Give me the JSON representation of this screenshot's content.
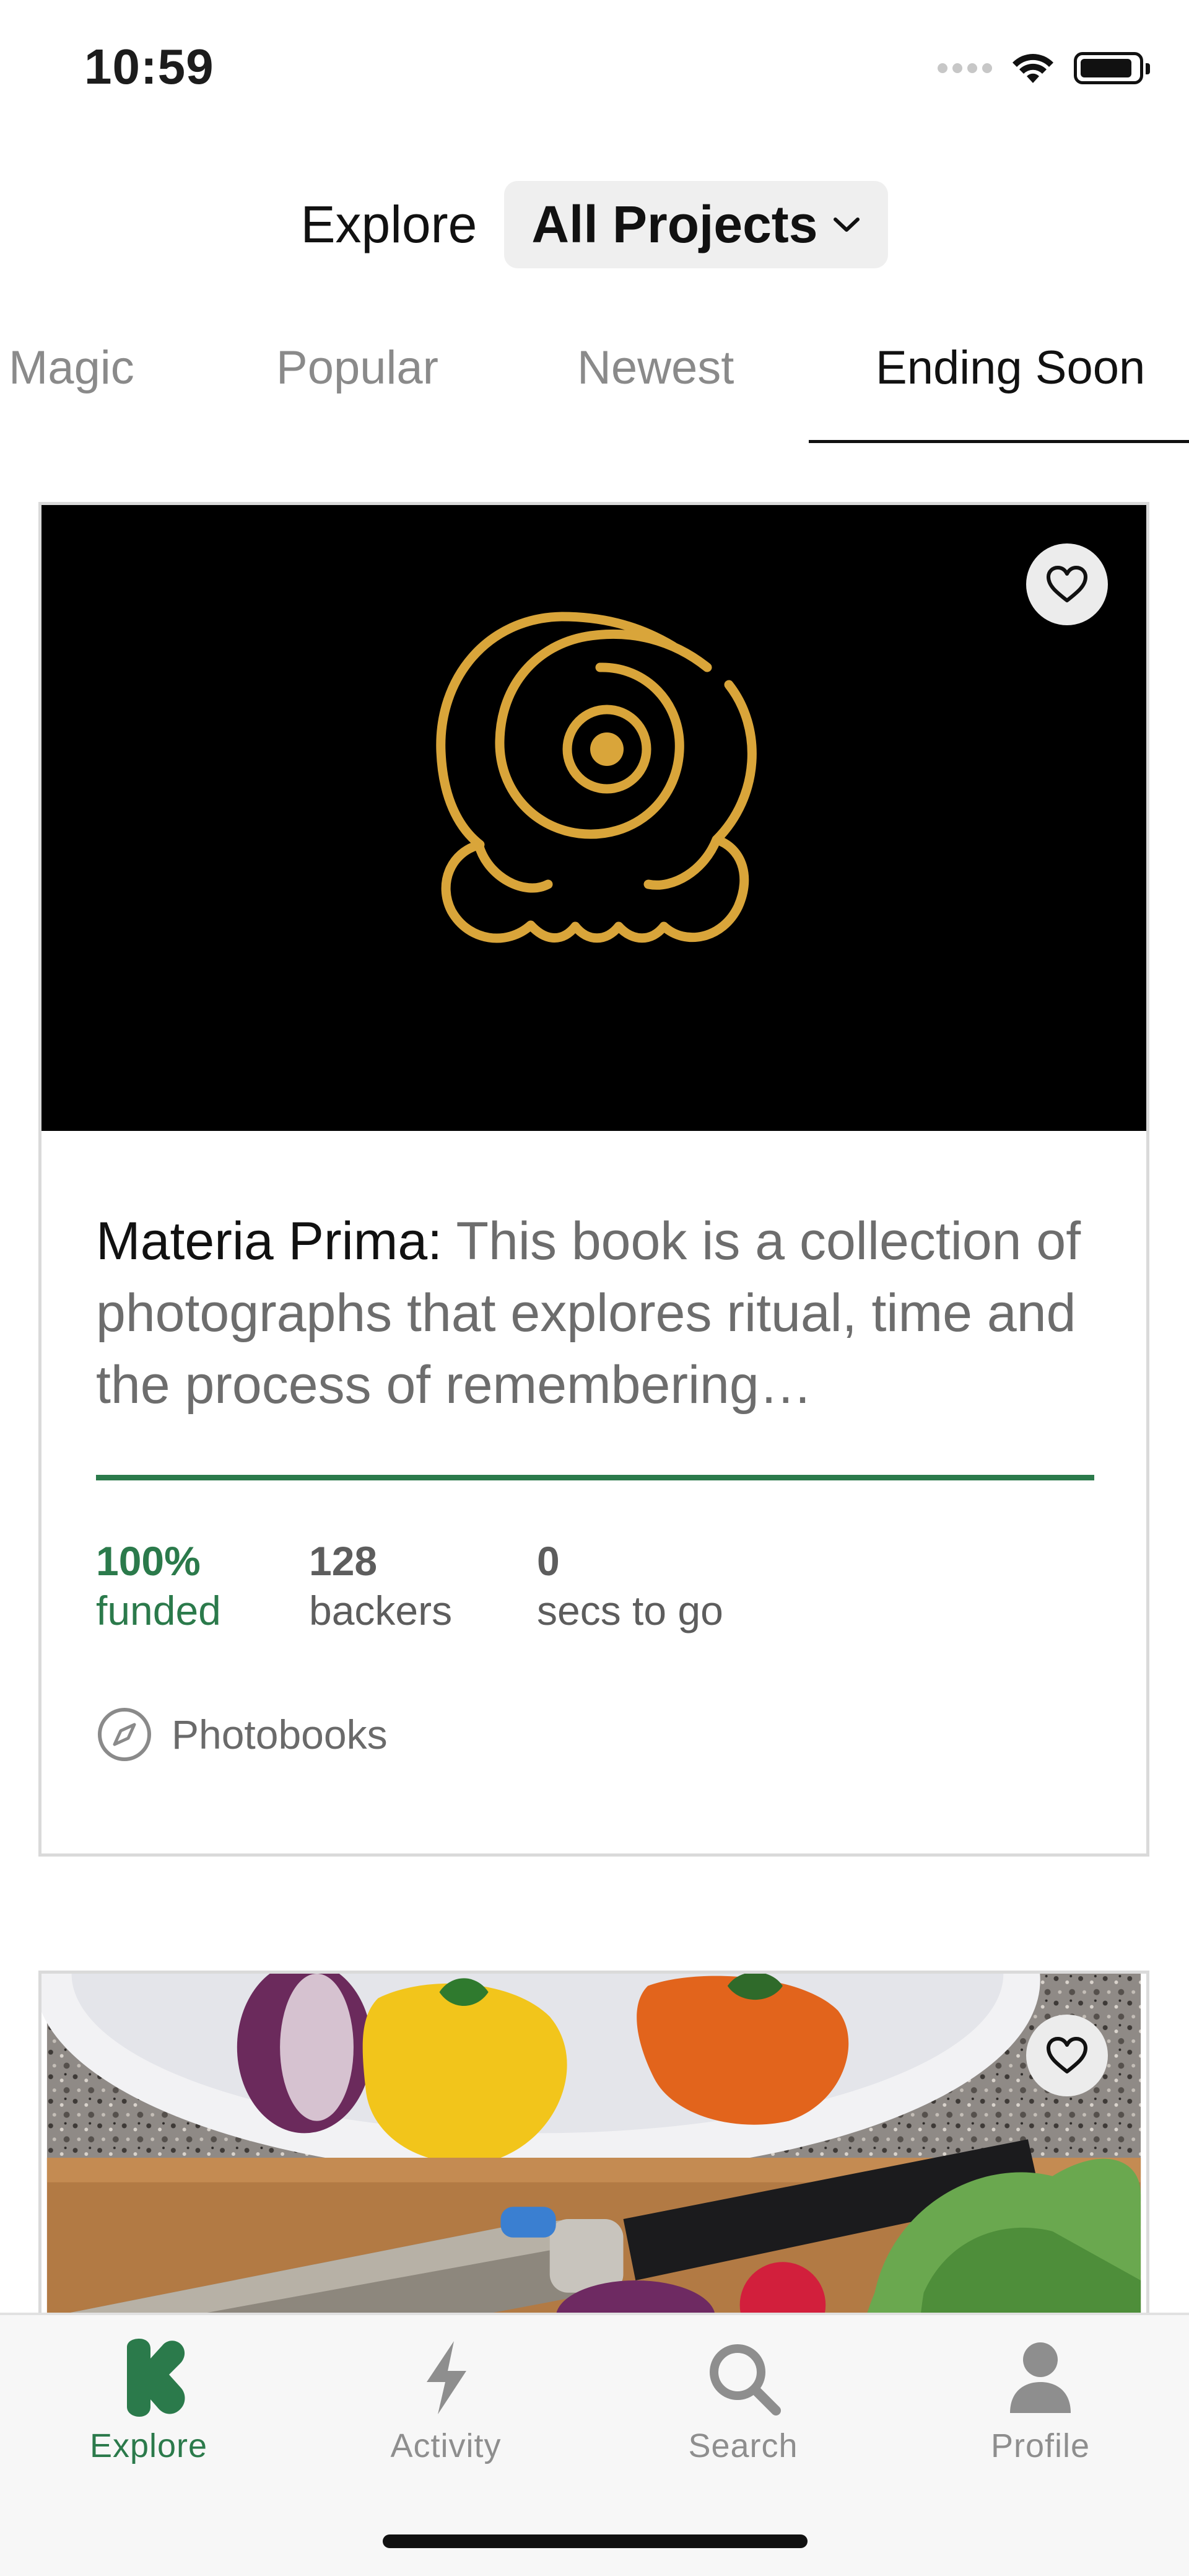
{
  "status_bar": {
    "time": "10:59"
  },
  "header": {
    "label": "Explore",
    "dropdown_value": "All Projects"
  },
  "tabs": [
    {
      "label": "Magic",
      "active": false
    },
    {
      "label": "Popular",
      "active": false
    },
    {
      "label": "Newest",
      "active": false
    },
    {
      "label": "Ending Soon",
      "active": true
    }
  ],
  "projects": [
    {
      "name": "Materia Prima:",
      "blurb": "This book is a collection of photographs that explores ritual, time and the process of remembering…",
      "funded_fraction": 1.0,
      "stats": {
        "funded_value": "100%",
        "funded_label": "funded",
        "backers_value": "128",
        "backers_label": "backers",
        "time_value": "0",
        "time_label": "secs to go"
      },
      "category": "Photobooks",
      "saved": false,
      "image_icon": "golden-spiral-logo"
    },
    {
      "saved": false,
      "image_icon": "vegetables-knife-photo"
    }
  ],
  "tab_bar": [
    {
      "label": "Explore",
      "icon": "kickstarter-k-icon",
      "active": true
    },
    {
      "label": "Activity",
      "icon": "lightning-icon",
      "active": false
    },
    {
      "label": "Search",
      "icon": "search-icon",
      "active": false
    },
    {
      "label": "Profile",
      "icon": "profile-icon",
      "active": false
    }
  ],
  "colors": {
    "accent_green": "#2b7a4b",
    "muted_text": "#8a8a8a",
    "hero_background": "#000000",
    "logo_gold": "#d9a53a"
  }
}
